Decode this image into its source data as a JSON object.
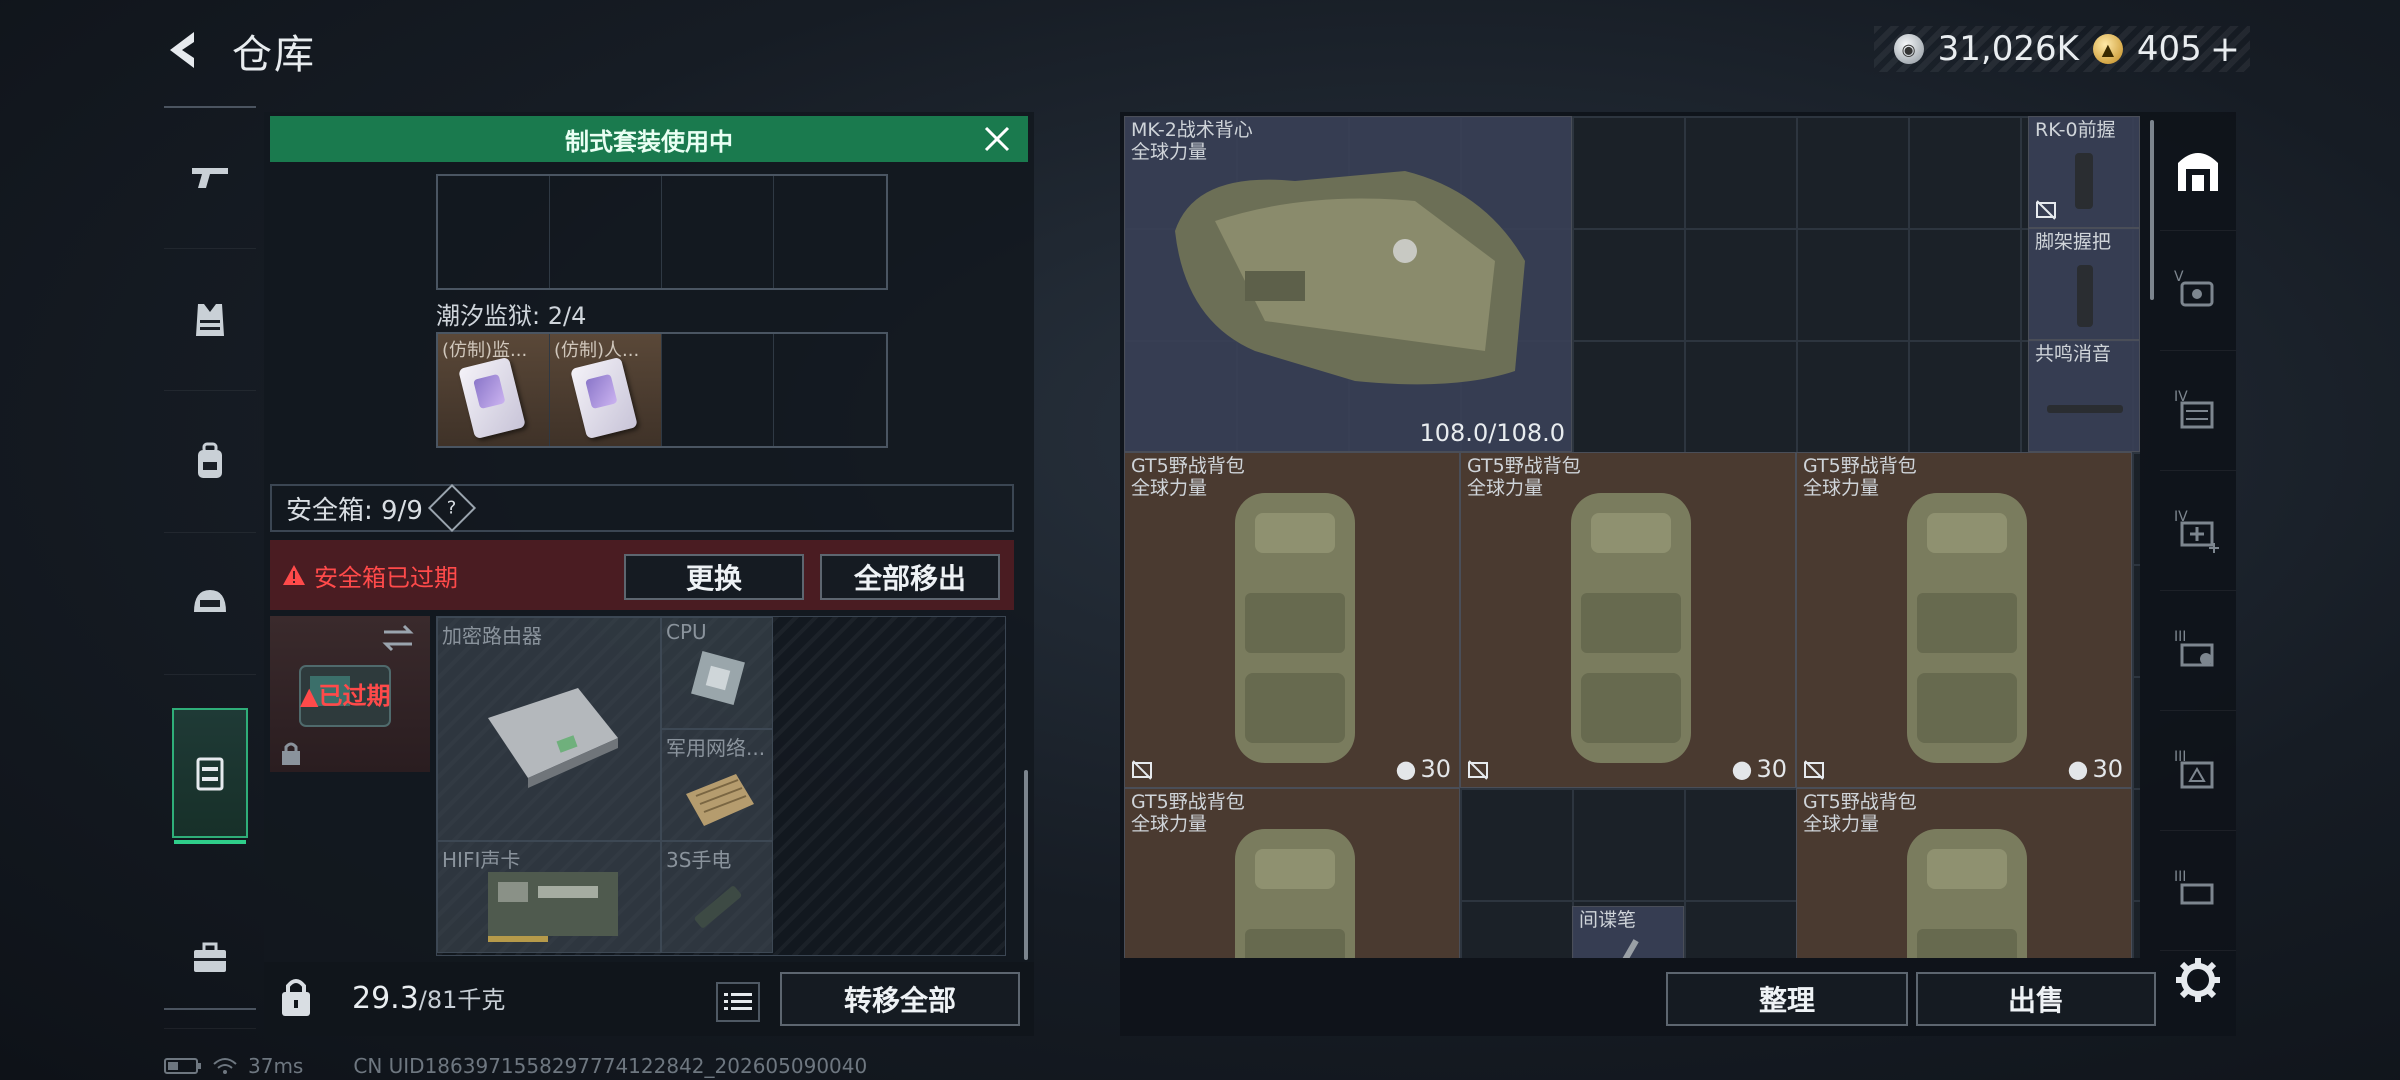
{
  "header": {
    "title": "仓库"
  },
  "currency": {
    "silver_value": "31,026K",
    "gold_value": "405",
    "plus": "+"
  },
  "left_panel": {
    "suit_banner": "制式套装使用中",
    "tide_prison_label": "潮汐监狱: 2/4",
    "tide_items": [
      "(仿制)监...",
      "(仿制)人..."
    ],
    "safe_box_label": "安全箱: 9/9",
    "safe_help": "?",
    "expired_notice": "安全箱已过期",
    "replace_button": "更换",
    "remove_all_button": "全部移出",
    "safe_expired_badge": "已过期",
    "safe_items": [
      "加密路由器",
      "CPU",
      "军用网络...",
      "HIFI声卡",
      "3S手电"
    ],
    "weight_current": "29.3",
    "weight_max": "/81千克",
    "transfer_all_button": "转移全部"
  },
  "right_panel": {
    "vest": {
      "name": "MK-2战术背心",
      "sub": "全球力量",
      "durability": "108.0/108.0"
    },
    "attachments": [
      "RK-0前握",
      "脚架握把",
      "共鸣消音"
    ],
    "packs": [
      {
        "name": "GT5野战背包",
        "sub": "全球力量",
        "capacity": "30"
      },
      {
        "name": "GT5野战背包",
        "sub": "全球力量",
        "capacity": "30"
      },
      {
        "name": "GT5野战背包",
        "sub": "全球力量",
        "capacity": "30"
      },
      {
        "name": "GT5野战背包",
        "sub": "全球力量",
        "capacity": ""
      },
      {
        "name": "GT5野战背包",
        "sub": "全球力量",
        "capacity": ""
      }
    ],
    "small_item": "间谍笔",
    "sort_button": "整理",
    "sell_button": "出售"
  },
  "footer": {
    "ping": "37ms",
    "uid": "CN UID1863971558297774122842_202605090040"
  },
  "colors": {
    "accent_green": "#1a7a4e",
    "alert_red": "#ff4a4a",
    "pack_brown": "#4a3a30",
    "vest_blue": "#3a4056"
  }
}
